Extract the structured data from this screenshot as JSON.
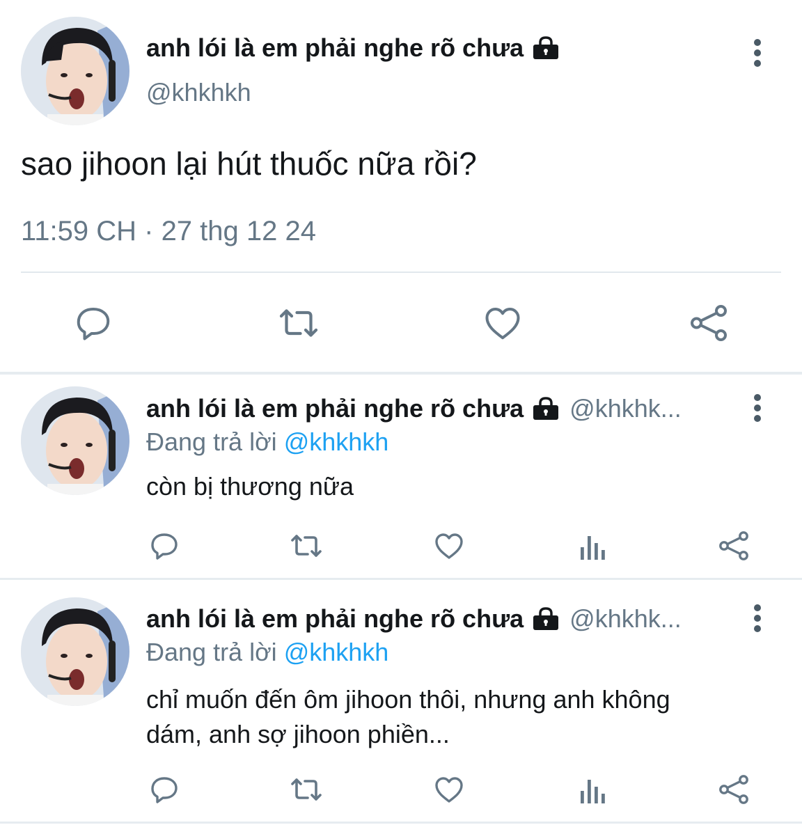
{
  "main_tweet": {
    "display_name": "anh lói là em phải nghe rõ chưa",
    "handle": "@khkhkh",
    "text": "sao jihoon lại hút thuốc nữa rồi?",
    "timestamp": "11:59 CH · 27 thg 12 24",
    "icons": [
      "reply-icon",
      "retweet-icon",
      "like-icon",
      "share-icon",
      "more-options-icon",
      "lock-icon"
    ]
  },
  "replies": [
    {
      "display_name": "anh lói là em phải nghe rõ chưa",
      "handle": "@khkhk...",
      "replying_prefix": "Đang trả lời",
      "replying_to": "@khkhkh",
      "text": "còn bị thương nữa"
    },
    {
      "display_name": "anh lói là em phải nghe rõ chưa",
      "handle": "@khkhk...",
      "replying_prefix": "Đang trả lời",
      "replying_to": "@khkhkh",
      "text_line1": "chỉ muốn đến ôm jihoon thôi, nhưng anh không",
      "text_line2": "dám, anh sợ jihoon phiền..."
    }
  ],
  "reply_icons": [
    "reply-icon",
    "retweet-icon",
    "like-icon",
    "views-icon",
    "share-icon"
  ],
  "colors": {
    "text": "#14171a",
    "secondary": "#657786",
    "mention": "#1da1f2",
    "divider": "#e1e8ed"
  }
}
